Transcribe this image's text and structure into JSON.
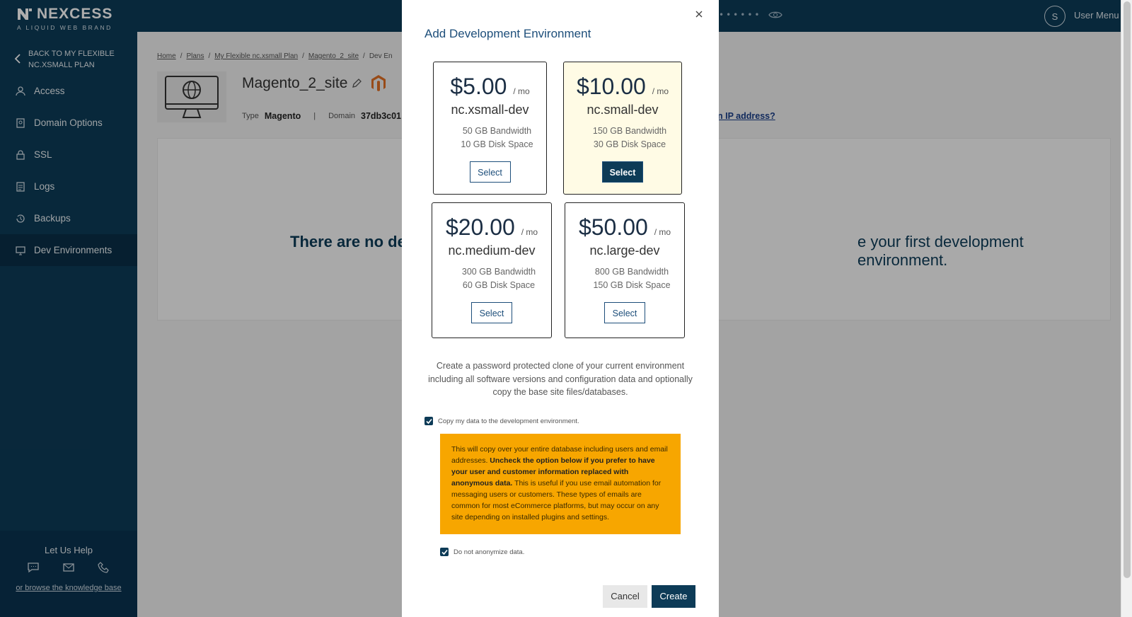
{
  "brand": {
    "name": "NEXCESS",
    "tagline": "A LIQUID WEB BRAND"
  },
  "sidebar": {
    "back_label": "BACK TO MY FLEXIBLE NC.XSMALL PLAN",
    "items": [
      {
        "label": "Access",
        "icon": "person-icon"
      },
      {
        "label": "Domain Options",
        "icon": "document-icon"
      },
      {
        "label": "SSL",
        "icon": "lock-icon"
      },
      {
        "label": "Logs",
        "icon": "list-icon"
      },
      {
        "label": "Backups",
        "icon": "history-icon"
      },
      {
        "label": "Dev Environments",
        "icon": "monitor-icon",
        "active": true
      }
    ],
    "help": {
      "title": "Let Us Help",
      "kb_link": "or browse the knowledge base"
    }
  },
  "topbar": {
    "masked": "••••••",
    "avatar_initial": "S",
    "user_menu": "User Menu"
  },
  "breadcrumb": [
    "Home",
    "Plans",
    "My Flexible nc.xsmall Plan",
    "Magento_2_site",
    "Dev En"
  ],
  "site": {
    "name": "Magento_2_site",
    "type_label": "Type",
    "type_value": "Magento",
    "domain_label": "Domain",
    "domain_value": "37db3c01",
    "ip_link": "n IP address?"
  },
  "empty_state": {
    "left": "There are no de",
    "right": "e your first development environment."
  },
  "modal": {
    "title": "Add Development Environment",
    "plans": [
      {
        "price": "$5.00",
        "per": "/ mo",
        "name": "nc.xsmall-dev",
        "bandwidth": "50 GB Bandwidth",
        "disk": "10 GB Disk Space",
        "button": "Select",
        "selected": false
      },
      {
        "price": "$10.00",
        "per": "/ mo",
        "name": "nc.small-dev",
        "bandwidth": "150 GB Bandwidth",
        "disk": "30 GB Disk Space",
        "button": "Select",
        "selected": true
      },
      {
        "price": "$20.00",
        "per": "/ mo",
        "name": "nc.medium-dev",
        "bandwidth": "300 GB Bandwidth",
        "disk": "60 GB Disk Space",
        "button": "Select",
        "selected": false
      },
      {
        "price": "$50.00",
        "per": "/ mo",
        "name": "nc.large-dev",
        "bandwidth": "800 GB Bandwidth",
        "disk": "150 GB Disk Space",
        "button": "Select",
        "selected": false
      }
    ],
    "description": "Create a password protected clone of your current environment including all software versions and configuration data and optionally copy the base site files/databases.",
    "copy_data_label": "Copy my data to the development environment.",
    "warning": {
      "part1": "This will copy over your entire database including users and email addresses. ",
      "bold": "Uncheck the option below if you prefer to have your user and customer information replaced with anonymous data.",
      "part2": " This is useful if you use email automation for messaging users or customers. These types of emails are common for most eCommerce platforms, but may occur on any site depending on installed plugins and settings."
    },
    "anonymize_label": "Do not anonymize data.",
    "cancel": "Cancel",
    "create": "Create"
  },
  "colors": {
    "navy": "#0d3b57",
    "warning": "#f7a600",
    "selected_bg": "#fffbe5"
  }
}
